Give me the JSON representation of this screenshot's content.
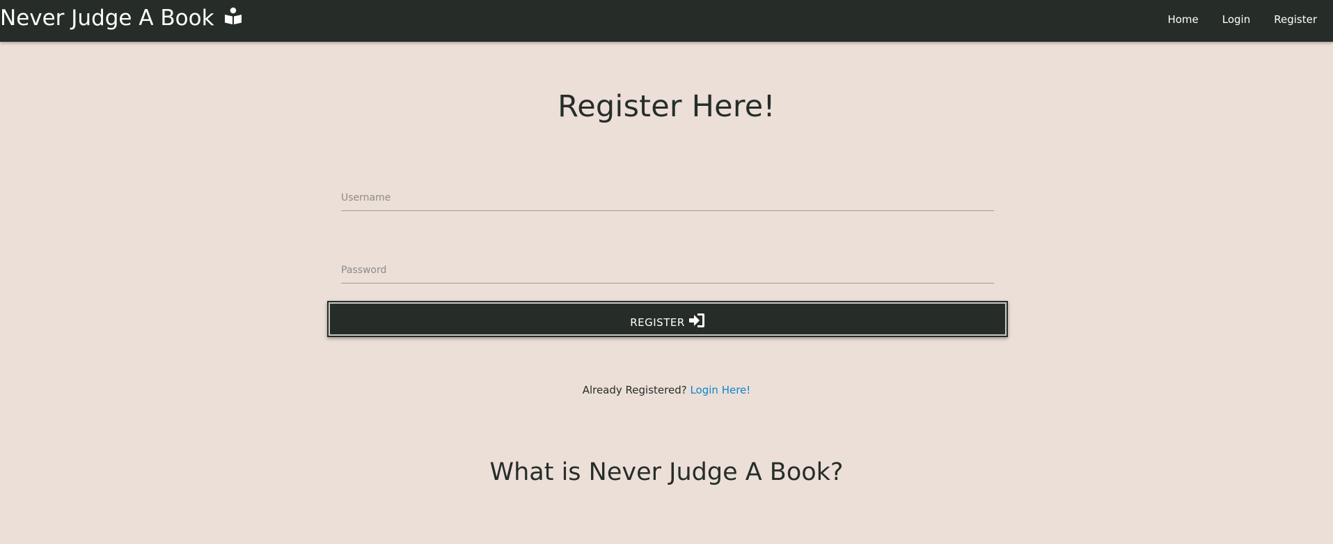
{
  "navbar": {
    "brand": "Never Judge A Book",
    "brand_icon": "book-reader-icon",
    "links": [
      "Home",
      "Login",
      "Register"
    ]
  },
  "form": {
    "title": "Register Here!",
    "username_placeholder": "Username",
    "password_placeholder": "Password",
    "submit_label": "REGISTER",
    "submit_icon": "sign-in-icon",
    "already_text": "Already Registered?",
    "login_link": "Login Here!"
  },
  "about": {
    "heading": "What is Never Judge A Book?"
  },
  "colors": {
    "background": "#ecdfd8",
    "navbar": "#262d29",
    "link": "#0b86c9"
  }
}
